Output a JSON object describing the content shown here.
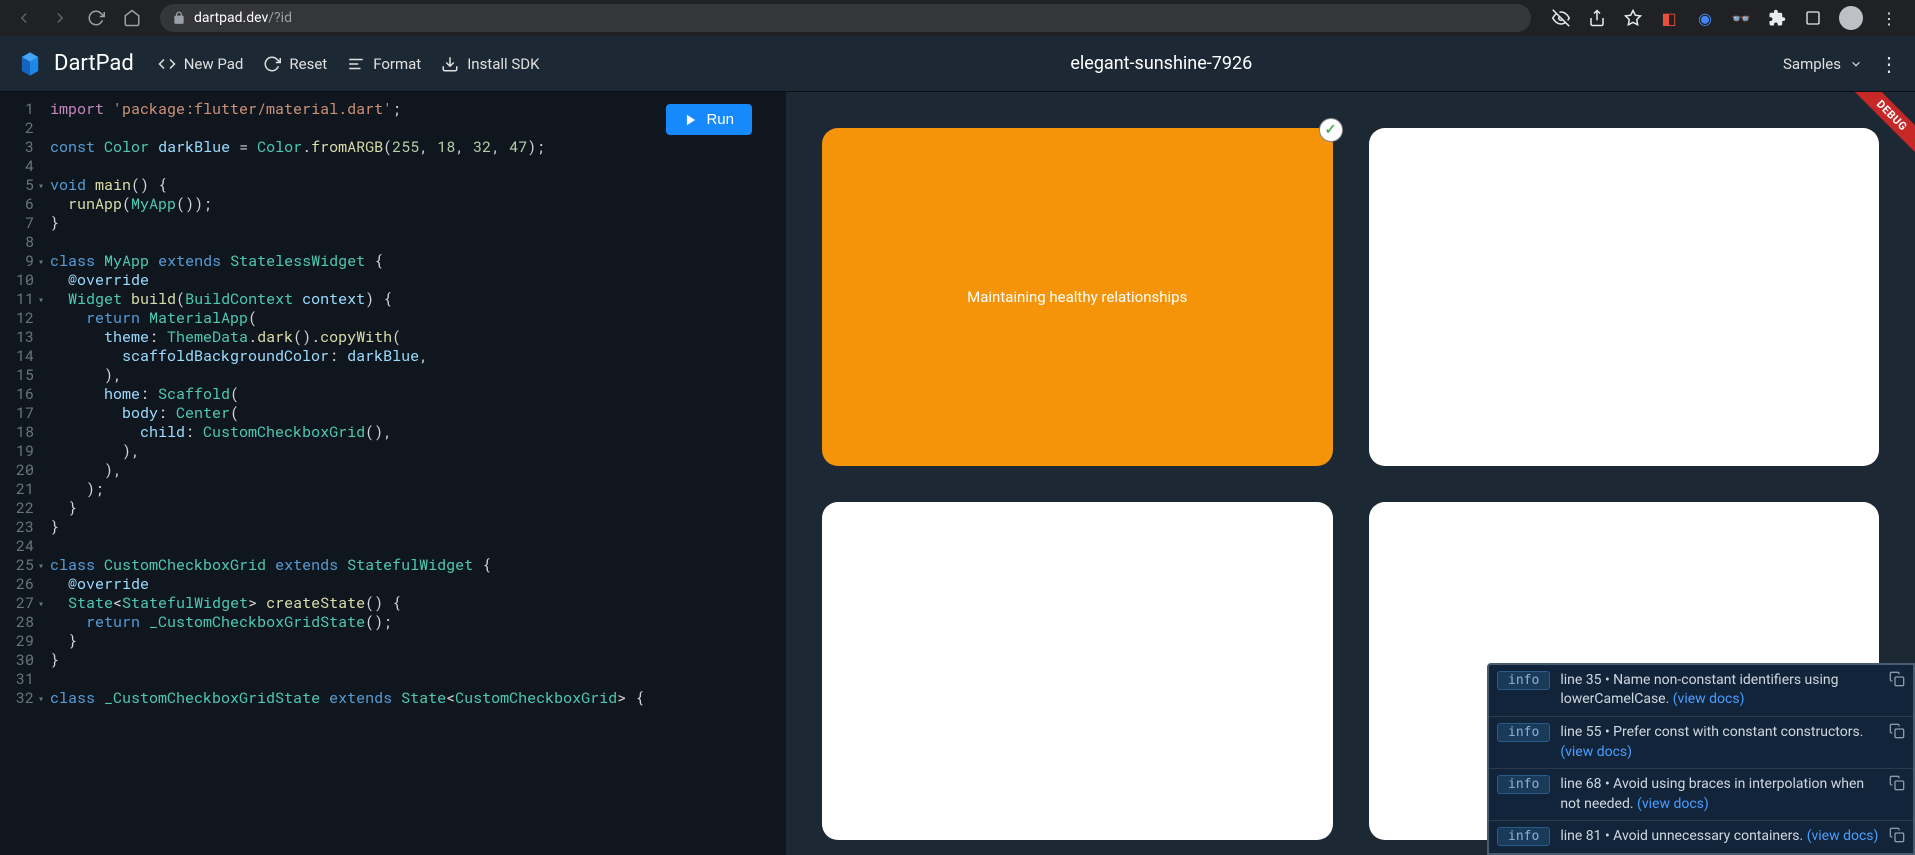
{
  "browser": {
    "url_host": "dartpad.dev",
    "url_path": "/?id"
  },
  "header": {
    "logo": "DartPad",
    "actions": {
      "new_pad": "New Pad",
      "reset": "Reset",
      "format": "Format",
      "install": "Install SDK"
    },
    "title": "elegant-sunshine-7926",
    "samples": "Samples"
  },
  "editor": {
    "run": "Run",
    "lines": [
      {
        "n": "1",
        "fold": "",
        "html": "<span class='tok-import'>import</span> <span class='tok-str'>'package:flutter/material.dart'</span><span class='tok-white'>;</span>"
      },
      {
        "n": "2",
        "fold": "",
        "html": ""
      },
      {
        "n": "3",
        "fold": "",
        "html": "<span class='tok-kw'>const</span> <span class='tok-type'>Color</span> <span class='tok-var'>darkBlue</span> <span class='tok-white'>=</span> <span class='tok-type'>Color</span><span class='tok-white'>.</span><span class='tok-fn'>fromARGB</span><span class='tok-white'>(</span><span class='tok-num'>255</span><span class='tok-white'>, </span><span class='tok-num'>18</span><span class='tok-white'>, </span><span class='tok-num'>32</span><span class='tok-white'>, </span><span class='tok-num'>47</span><span class='tok-white'>);</span>"
      },
      {
        "n": "4",
        "fold": "",
        "html": ""
      },
      {
        "n": "5",
        "fold": "▾",
        "html": "<span class='tok-kw'>void</span> <span class='tok-fn'>main</span><span class='tok-white'>() {</span>"
      },
      {
        "n": "6",
        "fold": "",
        "html": "  <span class='tok-fn'>runApp</span><span class='tok-white'>(</span><span class='tok-type'>MyApp</span><span class='tok-white'>());</span>"
      },
      {
        "n": "7",
        "fold": "",
        "html": "<span class='tok-white'>}</span>"
      },
      {
        "n": "8",
        "fold": "",
        "html": ""
      },
      {
        "n": "9",
        "fold": "▾",
        "html": "<span class='tok-kw'>class</span> <span class='tok-type'>MyApp</span> <span class='tok-kw'>extends</span> <span class='tok-type'>StatelessWidget</span> <span class='tok-white'>{</span>"
      },
      {
        "n": "10",
        "fold": "",
        "html": "  <span class='tok-annot'>@override</span>"
      },
      {
        "n": "11",
        "fold": "▾",
        "html": "  <span class='tok-type'>Widget</span> <span class='tok-fn'>build</span><span class='tok-white'>(</span><span class='tok-type'>BuildContext</span> <span class='tok-var'>context</span><span class='tok-white'>) {</span>"
      },
      {
        "n": "12",
        "fold": "",
        "html": "    <span class='tok-kw'>return</span> <span class='tok-type'>MaterialApp</span><span class='tok-white'>(</span>"
      },
      {
        "n": "13",
        "fold": "",
        "html": "      <span class='tok-prop'>theme</span><span class='tok-white'>: </span><span class='tok-type'>ThemeData</span><span class='tok-white'>.</span><span class='tok-fn'>dark</span><span class='tok-white'>().</span><span class='tok-fn'>copyWith</span><span class='tok-white'>(</span>"
      },
      {
        "n": "14",
        "fold": "",
        "html": "        <span class='tok-prop'>scaffoldBackgroundColor</span><span class='tok-white'>: </span><span class='tok-var'>darkBlue</span><span class='tok-white'>,</span>"
      },
      {
        "n": "15",
        "fold": "",
        "html": "      <span class='tok-white'>),</span>"
      },
      {
        "n": "16",
        "fold": "",
        "html": "      <span class='tok-prop'>home</span><span class='tok-white'>: </span><span class='tok-type'>Scaffold</span><span class='tok-white'>(</span>"
      },
      {
        "n": "17",
        "fold": "",
        "html": "        <span class='tok-prop'>body</span><span class='tok-white'>: </span><span class='tok-type'>Center</span><span class='tok-white'>(</span>"
      },
      {
        "n": "18",
        "fold": "",
        "html": "          <span class='tok-prop'>child</span><span class='tok-white'>: </span><span class='tok-type'>CustomCheckboxGrid</span><span class='tok-white'>(),</span>"
      },
      {
        "n": "19",
        "fold": "",
        "html": "        <span class='tok-white'>),</span>"
      },
      {
        "n": "20",
        "fold": "",
        "html": "      <span class='tok-white'>),</span>"
      },
      {
        "n": "21",
        "fold": "",
        "html": "    <span class='tok-white'>);</span>"
      },
      {
        "n": "22",
        "fold": "",
        "html": "  <span class='tok-white'>}</span>"
      },
      {
        "n": "23",
        "fold": "",
        "html": "<span class='tok-white'>}</span>"
      },
      {
        "n": "24",
        "fold": "",
        "html": ""
      },
      {
        "n": "25",
        "fold": "▾",
        "html": "<span class='tok-kw'>class</span> <span class='tok-type'>CustomCheckboxGrid</span> <span class='tok-kw'>extends</span> <span class='tok-type'>StatefulWidget</span> <span class='tok-white'>{</span>"
      },
      {
        "n": "26",
        "fold": "",
        "html": "  <span class='tok-annot'>@override</span>"
      },
      {
        "n": "27",
        "fold": "▾",
        "html": "  <span class='tok-type'>State</span><span class='tok-white'>&lt;</span><span class='tok-type'>StatefulWidget</span><span class='tok-white'>&gt; </span><span class='tok-fn'>createState</span><span class='tok-white'>() {</span>"
      },
      {
        "n": "28",
        "fold": "",
        "html": "    <span class='tok-kw'>return</span> <span class='tok-type'>_CustomCheckboxGridState</span><span class='tok-white'>();</span>"
      },
      {
        "n": "29",
        "fold": "",
        "html": "  <span class='tok-white'>}</span>"
      },
      {
        "n": "30",
        "fold": "",
        "html": "<span class='tok-white'>}</span>"
      },
      {
        "n": "31",
        "fold": "",
        "html": ""
      },
      {
        "n": "32",
        "fold": "▾",
        "html": "<span class='tok-kw'>class</span> <span class='tok-type'>_CustomCheckboxGridState</span> <span class='tok-kw'>extends</span> <span class='tok-type'>State</span><span class='tok-white'>&lt;</span><span class='tok-type'>CustomCheckboxGrid</span><span class='tok-white'>&gt; {</span>"
      }
    ]
  },
  "preview": {
    "card1_text": "Maintaining healthy relationships",
    "debug": "DEBUG"
  },
  "issues": [
    {
      "level": "info",
      "text": "line 35 • Name non-constant identifiers using lowerCamelCase.",
      "link": "(view docs)"
    },
    {
      "level": "info",
      "text": "line 55 • Prefer const with constant constructors.",
      "link": "(view docs)"
    },
    {
      "level": "info",
      "text": "line 68 • Avoid using braces in interpolation when not needed.",
      "link": "(view docs)"
    },
    {
      "level": "info",
      "text": "line 81 • Avoid unnecessary containers.",
      "link": "(view docs)"
    }
  ]
}
